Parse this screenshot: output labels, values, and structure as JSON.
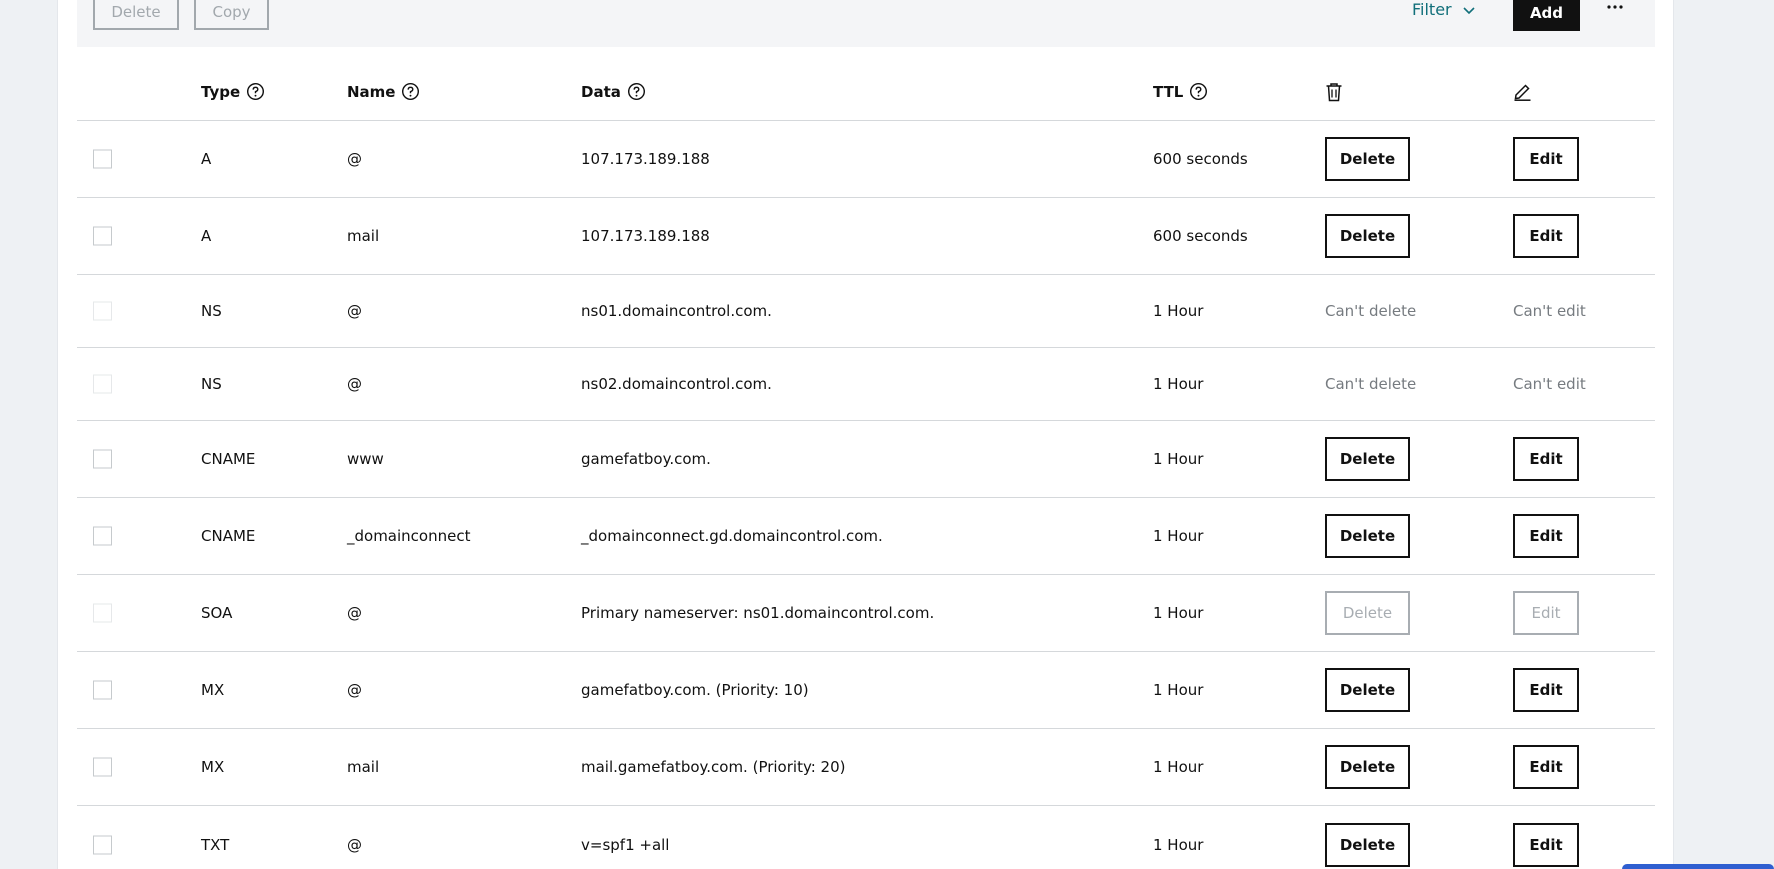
{
  "toolbar": {
    "delete_label": "Delete",
    "copy_label": "Copy",
    "filter_label": "Filter",
    "add_label": "Add"
  },
  "table": {
    "headers": {
      "type": "Type",
      "name": "Name",
      "data": "Data",
      "ttl": "TTL"
    },
    "rows": [
      {
        "type": "A",
        "name": "@",
        "data": "107.173.189.188",
        "ttl": "600 seconds",
        "delete": "Delete",
        "edit": "Edit"
      },
      {
        "type": "A",
        "name": "mail",
        "data": "107.173.189.188",
        "ttl": "600 seconds",
        "delete": "Delete",
        "edit": "Edit"
      },
      {
        "type": "NS",
        "name": "@",
        "data": "ns01.domaincontrol.com.",
        "ttl": "1 Hour",
        "delete": "Can't delete",
        "edit": "Can't edit"
      },
      {
        "type": "NS",
        "name": "@",
        "data": "ns02.domaincontrol.com.",
        "ttl": "1 Hour",
        "delete": "Can't delete",
        "edit": "Can't edit"
      },
      {
        "type": "CNAME",
        "name": "www",
        "data": "gamefatboy.com.",
        "ttl": "1 Hour",
        "delete": "Delete",
        "edit": "Edit"
      },
      {
        "type": "CNAME",
        "name": "_domainconnect",
        "data": "_domainconnect.gd.domaincontrol.com.",
        "ttl": "1 Hour",
        "delete": "Delete",
        "edit": "Edit"
      },
      {
        "type": "SOA",
        "name": "@",
        "data": "Primary nameserver: ns01.domaincontrol.com.",
        "ttl": "1 Hour",
        "delete": "Delete",
        "edit": "Edit"
      },
      {
        "type": "MX",
        "name": "@",
        "data": "gamefatboy.com. (Priority: 10)",
        "ttl": "1 Hour",
        "delete": "Delete",
        "edit": "Edit"
      },
      {
        "type": "MX",
        "name": "mail",
        "data": "mail.gamefatboy.com. (Priority: 20)",
        "ttl": "1 Hour",
        "delete": "Delete",
        "edit": "Edit"
      },
      {
        "type": "TXT",
        "name": "@",
        "data": "v=spf1 +all",
        "ttl": "1 Hour",
        "delete": "Delete",
        "edit": "Edit"
      }
    ]
  },
  "colors": {
    "accent": "#116f7a",
    "primary_button": "#111111",
    "page_background": "#eef1f4",
    "toolbar_background": "#f4f5f7",
    "disabled": "#a8adb2"
  },
  "icons": {
    "help": "help-circle-icon",
    "delete_column": "trash-icon",
    "edit_column": "pencil-icon",
    "filter": "chevron-down-icon",
    "more": "more-horizontal-icon"
  }
}
